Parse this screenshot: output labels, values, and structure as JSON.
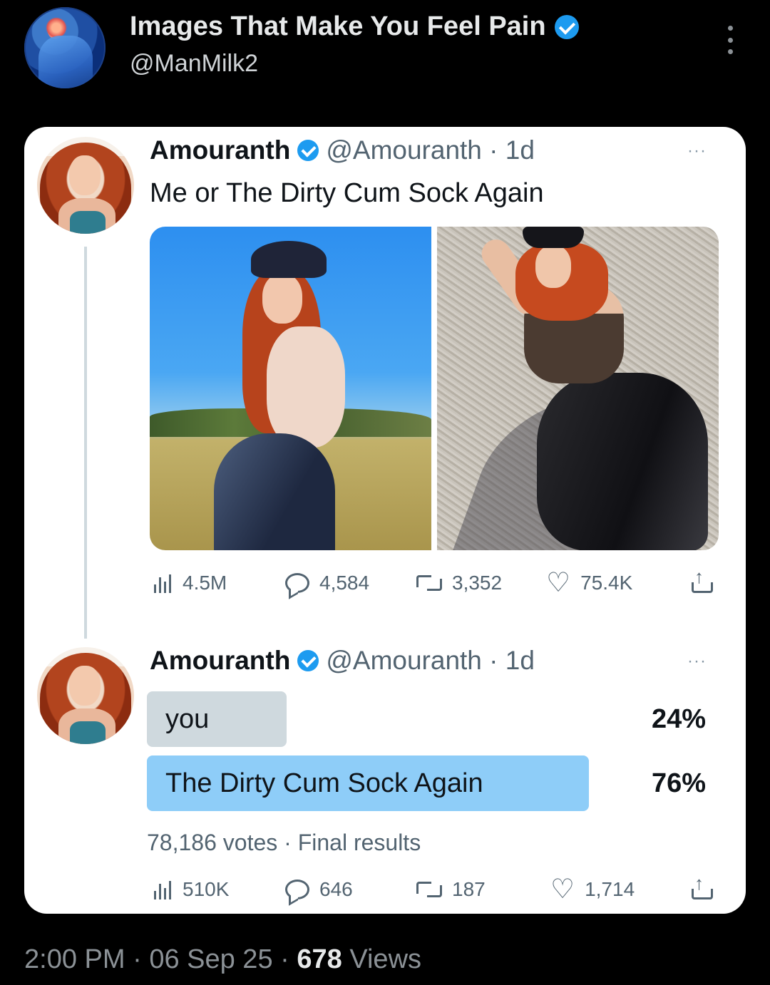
{
  "post": {
    "author_name": "Images That Make You Feel Pain",
    "author_handle": "@ManMilk2",
    "time": "2:00 PM",
    "date": "06 Sep 25",
    "views_count": "678",
    "views_label": "Views",
    "separator": "·"
  },
  "quoted": {
    "tweet1": {
      "name": "Amouranth",
      "handle_time": "@Amouranth · 1d",
      "text": "Me or The Dirty Cum Sock Again",
      "more": "···",
      "stats": {
        "views": "4.5M",
        "replies": "4,584",
        "reposts": "3,352",
        "likes": "75.4K"
      }
    },
    "tweet2": {
      "name": "Amouranth",
      "handle_time": "@Amouranth · 1d",
      "more": "···",
      "poll": {
        "options": [
          {
            "label": "you",
            "percent": "24%",
            "share": 0.24
          },
          {
            "label": "The Dirty Cum Sock Again",
            "percent": "76%",
            "share": 0.76,
            "winner": true
          }
        ],
        "footer": "78,186 votes · Final results"
      },
      "stats": {
        "views": "510K",
        "replies": "646",
        "reposts": "187",
        "likes": "1,714"
      }
    }
  },
  "colors": {
    "verified": "#1d9bf0",
    "poll_winner": "#8ecdf8",
    "poll_other": "#cfd9de"
  },
  "icons": [
    "verified-badge-icon",
    "more-options-icon",
    "views-icon",
    "reply-icon",
    "repost-icon",
    "like-icon",
    "share-icon"
  ]
}
